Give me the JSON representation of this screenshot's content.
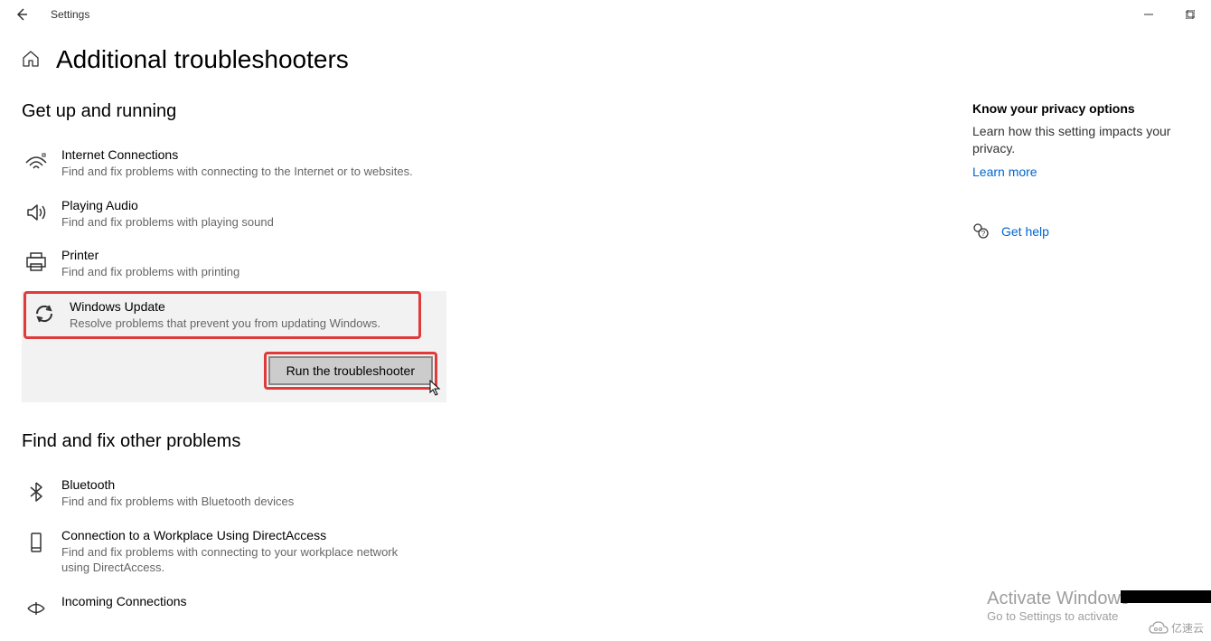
{
  "window": {
    "title": "Settings"
  },
  "header": {
    "page_title": "Additional troubleshooters"
  },
  "sections": {
    "getup": {
      "heading": "Get up and running",
      "items": [
        {
          "title": "Internet Connections",
          "desc": "Find and fix problems with connecting to the Internet or to websites."
        },
        {
          "title": "Playing Audio",
          "desc": "Find and fix problems with playing sound"
        },
        {
          "title": "Printer",
          "desc": "Find and fix problems with printing"
        },
        {
          "title": "Windows Update",
          "desc": "Resolve problems that prevent you from updating Windows."
        }
      ],
      "run_button": "Run the troubleshooter"
    },
    "other": {
      "heading": "Find and fix other problems",
      "items": [
        {
          "title": "Bluetooth",
          "desc": "Find and fix problems with Bluetooth devices"
        },
        {
          "title": "Connection to a Workplace Using DirectAccess",
          "desc": "Find and fix problems with connecting to your workplace network using DirectAccess."
        },
        {
          "title": "Incoming Connections",
          "desc": ""
        }
      ]
    }
  },
  "sidebar": {
    "privacy_heading": "Know your privacy options",
    "privacy_text": "Learn how this setting impacts your privacy.",
    "learn_more": "Learn more",
    "get_help": "Get help"
  },
  "activation": {
    "title": "Activate Windows",
    "sub": "Go to Settings to activate"
  },
  "watermark": {
    "label": "亿速云"
  }
}
